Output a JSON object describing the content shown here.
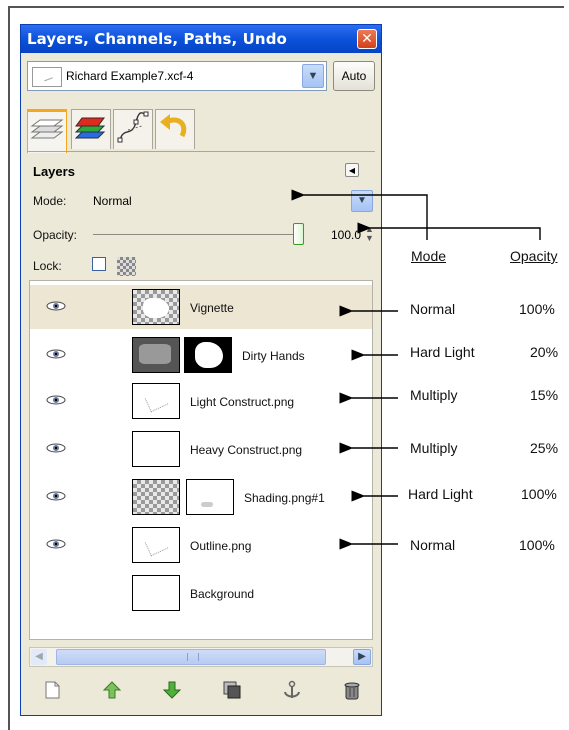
{
  "window": {
    "title": "Layers, Channels, Paths, Undo",
    "close_icon": "close-icon"
  },
  "image_selector": {
    "value": "Richard Example7.xcf-4",
    "auto_label": "Auto"
  },
  "tabs": [
    {
      "icon": "layers-tab-icon"
    },
    {
      "icon": "channels-tab-icon"
    },
    {
      "icon": "paths-tab-icon"
    },
    {
      "icon": "undo-tab-icon"
    }
  ],
  "panel": {
    "heading": "Layers",
    "mode_label": "Mode:",
    "mode_value": "Normal",
    "opacity_label": "Opacity:",
    "opacity_value": "100.0",
    "opacity_fraction": 1.0,
    "lock_label": "Lock:"
  },
  "layers": [
    {
      "name": "Vignette",
      "visible": true,
      "selected": true,
      "has_mask": false
    },
    {
      "name": "Dirty Hands",
      "visible": true,
      "selected": false,
      "has_mask": true
    },
    {
      "name": "Light Construct.png",
      "visible": true,
      "selected": false,
      "has_mask": false
    },
    {
      "name": "Heavy Construct.png",
      "visible": true,
      "selected": false,
      "has_mask": false
    },
    {
      "name": "Shading.png#1",
      "visible": true,
      "selected": false,
      "has_mask": true
    },
    {
      "name": "Outline.png",
      "visible": true,
      "selected": false,
      "has_mask": false
    },
    {
      "name": "Background",
      "visible": false,
      "selected": false,
      "has_mask": false
    }
  ],
  "bottom_toolbar": [
    "new-layer-icon",
    "raise-layer-icon",
    "lower-layer-icon",
    "duplicate-layer-icon",
    "anchor-layer-icon",
    "delete-layer-icon"
  ],
  "annotations": {
    "mode_header": "Mode",
    "opacity_header": "Opacity",
    "rows": [
      {
        "mode": "Normal",
        "opacity": "100%"
      },
      {
        "mode": "Hard Light",
        "opacity": "20%"
      },
      {
        "mode": "Multiply",
        "opacity": "15%"
      },
      {
        "mode": "Multiply",
        "opacity": "25%"
      },
      {
        "mode": "Hard Light",
        "opacity": "100%"
      },
      {
        "mode": "Normal",
        "opacity": "100%"
      }
    ]
  },
  "colors": {
    "titlebar": "#0a50d8",
    "selected_row": "#ede6d3",
    "active_tab": "#f3a820"
  }
}
